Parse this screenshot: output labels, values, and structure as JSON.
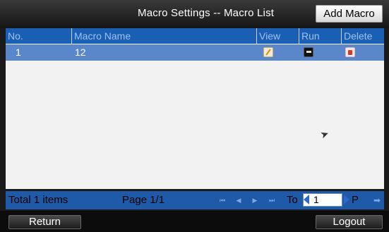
{
  "header": {
    "title": "Macro Settings -- Macro List",
    "add_button": "Add Macro"
  },
  "table": {
    "columns": [
      "No.",
      "Macro Name",
      "View",
      "Run",
      "Delete"
    ],
    "rows": [
      {
        "no": "1",
        "name": "12",
        "view_icon": "edit-icon",
        "run_icon": "run-icon",
        "delete_icon": "trash-icon"
      }
    ]
  },
  "pagination": {
    "total": "Total 1 items",
    "page": "Page 1/1",
    "to_label": "To",
    "to_value": "1",
    "p_label": "P"
  },
  "footer": {
    "return_label": "Return",
    "logout_label": "Logout"
  },
  "colors": {
    "header_blue": "#1a5fb4",
    "row_selected": "#5a87c9"
  }
}
